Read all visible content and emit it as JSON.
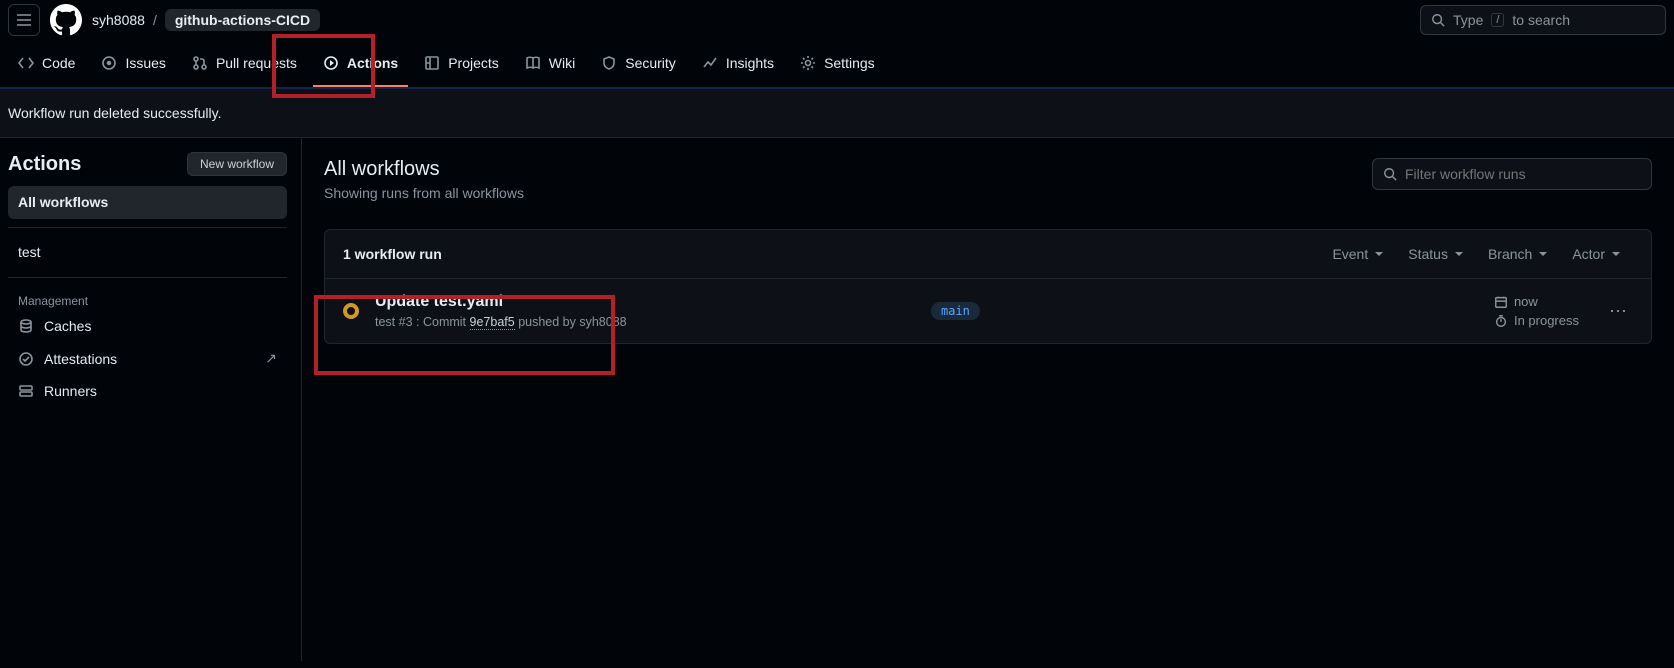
{
  "header": {
    "owner": "syh8088",
    "repo": "github-actions-CICD",
    "search_placeholder_pre": "Type ",
    "search_kbd": "/",
    "search_placeholder_post": " to search"
  },
  "repo_nav": {
    "code": "Code",
    "issues": "Issues",
    "pull_requests": "Pull requests",
    "actions": "Actions",
    "projects": "Projects",
    "wiki": "Wiki",
    "security": "Security",
    "insights": "Insights",
    "settings": "Settings"
  },
  "flash": "Workflow run deleted successfully.",
  "sidebar": {
    "title": "Actions",
    "new_workflow": "New workflow",
    "all_workflows": "All workflows",
    "workflows": [
      "test"
    ],
    "management_title": "Management",
    "management": {
      "caches": "Caches",
      "attestations": "Attestations",
      "runners": "Runners"
    }
  },
  "main": {
    "title": "All workflows",
    "subtitle": "Showing runs from all workflows",
    "filter_placeholder": "Filter workflow runs",
    "count_label": "1 workflow run",
    "filters": {
      "event": "Event",
      "status": "Status",
      "branch": "Branch",
      "actor": "Actor"
    },
    "run": {
      "title": "Update test.yaml",
      "workflow": "test",
      "run_number": "#3",
      "commit_prefix": ": Commit ",
      "sha": "9e7baf5",
      "pushed_by_prefix": " pushed by ",
      "actor": "syh8088",
      "branch": "main",
      "time": "now",
      "duration": "In progress"
    }
  }
}
